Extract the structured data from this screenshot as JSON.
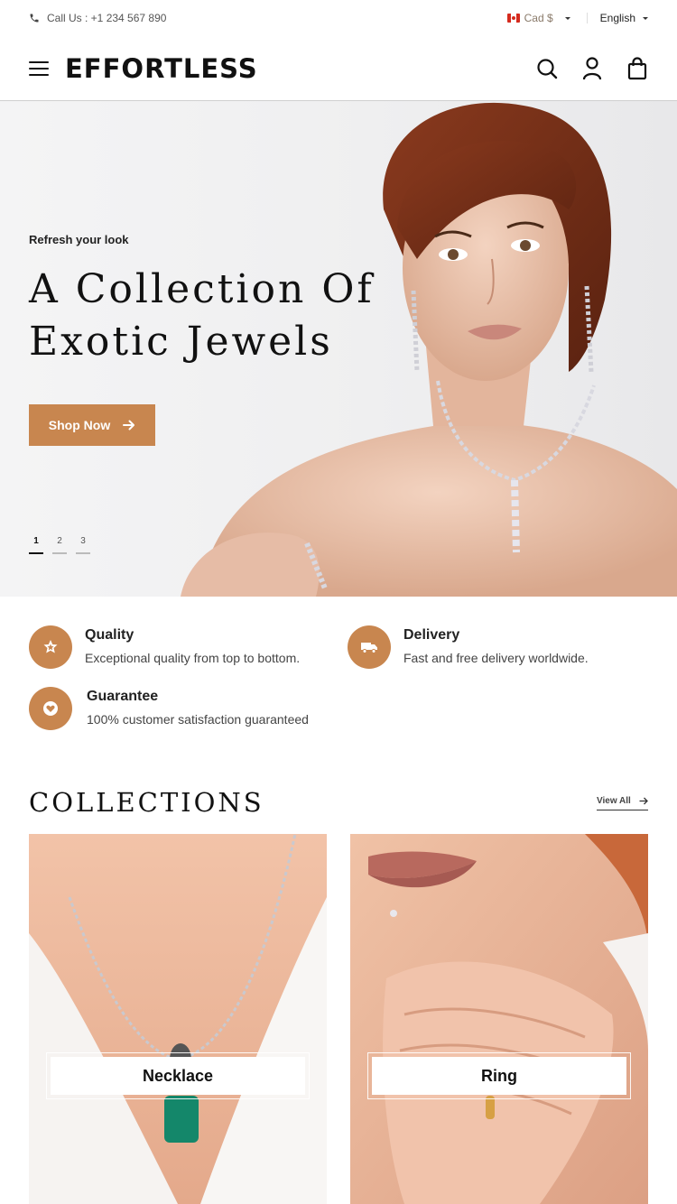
{
  "topbar": {
    "call_label": "Call Us : +1 234 567 890",
    "currency": "Cad $",
    "language": "English"
  },
  "header": {
    "logo": "EFFORTLESS",
    "icons": [
      "search-icon",
      "user-icon",
      "bag-icon"
    ]
  },
  "hero": {
    "eyebrow": "Refresh your look",
    "title": "A Collection Of Exotic Jewels",
    "button_label": "Shop Now",
    "slides": [
      "1",
      "2",
      "3"
    ],
    "active_slide": "1"
  },
  "features": [
    {
      "title": "Quality",
      "desc": "Exceptional quality from top to bottom.",
      "icon": "star-badge-icon"
    },
    {
      "title": "Delivery",
      "desc": "Fast and free delivery worldwide.",
      "icon": "truck-icon"
    },
    {
      "title": "Guarantee",
      "desc": "100% customer satisfaction guaranteed",
      "icon": "heart-badge-icon"
    }
  ],
  "collections": {
    "title": "COLLECTIONS",
    "view_all": "View All",
    "items": [
      {
        "label": "Necklace"
      },
      {
        "label": "Ring"
      }
    ]
  },
  "colors": {
    "accent": "#c8864f",
    "text": "#111111"
  }
}
